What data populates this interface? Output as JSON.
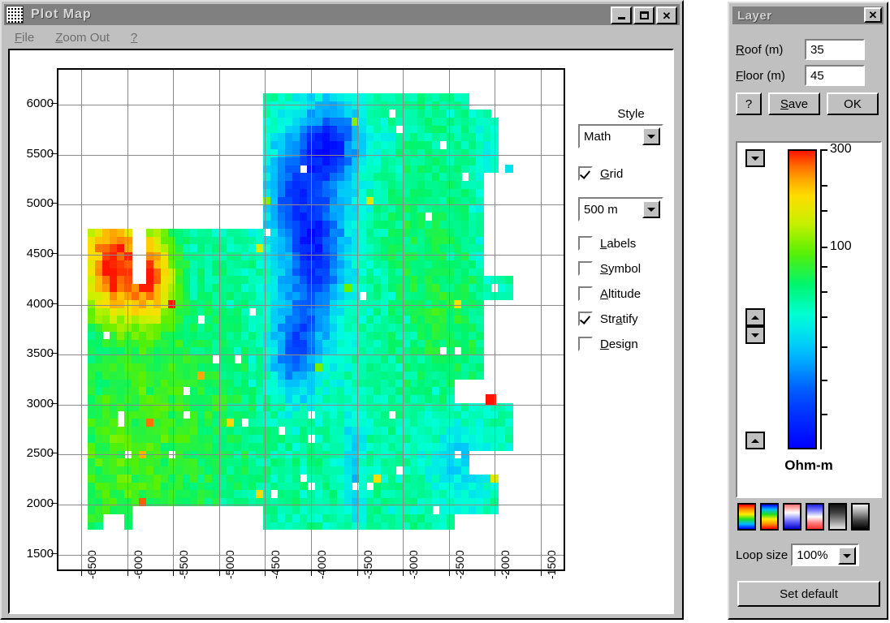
{
  "window": {
    "title": "Plot Map",
    "icon": "grid-icon",
    "minimize_label": "_",
    "maximize_label": "□",
    "close_label": "✕"
  },
  "menu": {
    "items": [
      {
        "label": "File",
        "mnemonic": "F"
      },
      {
        "label": "Zoom Out",
        "mnemonic": "Z"
      },
      {
        "label": "?",
        "mnemonic": "?"
      }
    ]
  },
  "controls": {
    "style_label": "Style",
    "style_value": "Math",
    "grid_label": "Grid",
    "grid_checked": true,
    "spacing_value": "500 m",
    "checkboxes": [
      {
        "label": "Labels",
        "checked": false
      },
      {
        "label": "Symbol",
        "checked": false
      },
      {
        "label": "Altitude",
        "checked": false
      },
      {
        "label": "Stratify",
        "checked": true
      },
      {
        "label": "Design",
        "checked": false
      }
    ]
  },
  "layer": {
    "title": "Layer",
    "close_label": "✕",
    "roof_label": "Roof (m)",
    "roof_value": "35",
    "floor_label": "Floor (m)",
    "floor_value": "45",
    "help_button": "?",
    "save_button": "Save",
    "ok_button": "OK",
    "unit_label": "Ohm-m",
    "scale_top_label": "300",
    "scale_mid_label": "100",
    "loop_size_label": "Loop size",
    "loop_size_value": "100%",
    "set_default_label": "Set default",
    "palettes": [
      "rainbow-blue-to-red",
      "rainbow-red-to-blue",
      "blue-white-red",
      "red-white-blue",
      "black-to-white",
      "white-to-black"
    ]
  },
  "chart_data": {
    "type": "heatmap",
    "title": "Plot Map",
    "xlabel": "",
    "ylabel": "",
    "colorbar_label": "Ohm-m",
    "colorbar_scale": "log",
    "colorbar_min": 10,
    "colorbar_max": 300,
    "colorbar_ticks": [
      300,
      100
    ],
    "grid": true,
    "grid_spacing_m": 500,
    "xlim": [
      -6750,
      -1250
    ],
    "ylim": [
      1350,
      6350
    ],
    "xticks": [
      -6500,
      -6000,
      -5500,
      -5000,
      -4500,
      -4000,
      -3500,
      -3000,
      -2500,
      -2000,
      -1500
    ],
    "yticks": [
      6000,
      5500,
      5000,
      4500,
      4000,
      3500,
      3000,
      2500,
      2000,
      1500
    ],
    "cell_size_m": 80,
    "description": "Resistivity survey map. High-resistivity (red/orange/yellow) anomaly in the west around x=-6300..-5700, y=3900..4800. Broad green mid-range body across the south and west. Low-resistivity (blue/cyan) zone dominating the centre-north around x=-4200..-3600, y=3800..6100. An isolated red high-resistivity cell near x=-2050, y=3050.",
    "regions": [
      {
        "name": "west-high-resistivity",
        "x_range": [
          -6400,
          -5650
        ],
        "y_range": [
          3850,
          4800
        ],
        "value_range": [
          120,
          300
        ]
      },
      {
        "name": "south-west-mid",
        "x_range": [
          -6500,
          -4600
        ],
        "y_range": [
          1700,
          3900
        ],
        "value_range": [
          50,
          110
        ]
      },
      {
        "name": "central-low",
        "x_range": [
          -4500,
          -3500
        ],
        "y_range": [
          3500,
          6200
        ],
        "value_range": [
          12,
          45
        ]
      },
      {
        "name": "east-mid",
        "x_range": [
          -3400,
          -1900
        ],
        "y_range": [
          1700,
          6200
        ],
        "value_range": [
          40,
          80
        ]
      },
      {
        "name": "isolated-high-cell",
        "x_range": [
          -2100,
          -2000
        ],
        "y_range": [
          3000,
          3100
        ],
        "value_range": [
          290,
          300
        ]
      }
    ]
  }
}
